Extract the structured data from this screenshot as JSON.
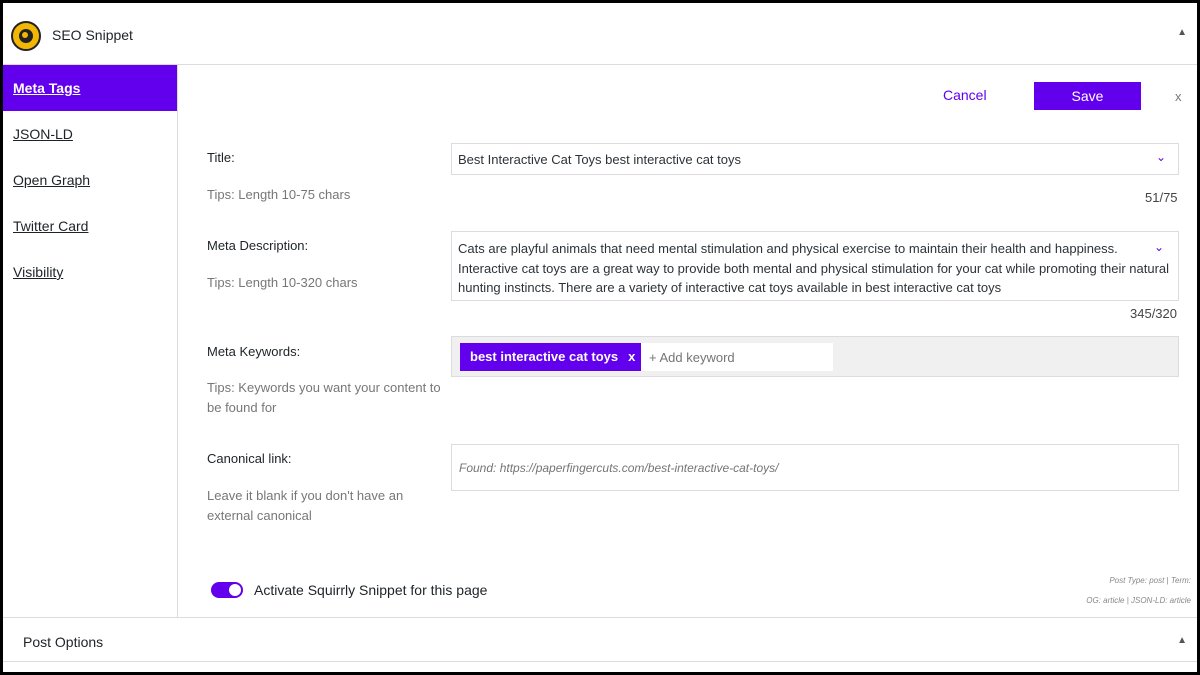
{
  "header": {
    "title": "SEO Snippet",
    "collapse_icon": "▲"
  },
  "sidebar": {
    "items": [
      {
        "label": "Meta Tags"
      },
      {
        "label": "JSON-LD"
      },
      {
        "label": "Open Graph"
      },
      {
        "label": "Twitter Card"
      },
      {
        "label": "Visibility"
      }
    ]
  },
  "toolbar": {
    "cancel_label": "Cancel",
    "save_label": "Save",
    "close_label": "x"
  },
  "form": {
    "title": {
      "label": "Title:",
      "tip": "Tips: Length 10-75 chars",
      "value": "Best Interactive Cat Toys best interactive cat toys",
      "counter": "51/75"
    },
    "description": {
      "label": "Meta Description:",
      "tip": "Tips: Length 10-320 chars",
      "value": "Cats are playful animals that need mental stimulation and physical exercise to maintain their health and happiness. Interactive cat toys are a great way to provide both mental and physical stimulation for your cat while promoting their natural hunting instincts. There are a variety of interactive cat toys available in best interactive cat toys",
      "counter": "345/320"
    },
    "keywords": {
      "label": "Meta Keywords:",
      "tip": "Tips: Keywords you want your content to be found for",
      "tags": [
        "best interactive cat toys"
      ],
      "tag_remove": "x",
      "placeholder": "+ Add keyword"
    },
    "canonical": {
      "label": "Canonical link:",
      "tip": "Leave it blank if you don't have an external canonical",
      "placeholder": "Found: https://paperfingercuts.com/best-interactive-cat-toys/"
    },
    "chevron": "⌄"
  },
  "activate": {
    "label": "Activate Squirrly Snippet for this page",
    "enabled": true
  },
  "meta_info": {
    "line1": "Post Type: post | Term:",
    "line2": "OG: article | JSON-LD: article"
  },
  "footer": {
    "title": "Post Options",
    "collapse_icon": "▲"
  },
  "colors": {
    "accent": "#6200ee",
    "logo": "#f2b705"
  }
}
